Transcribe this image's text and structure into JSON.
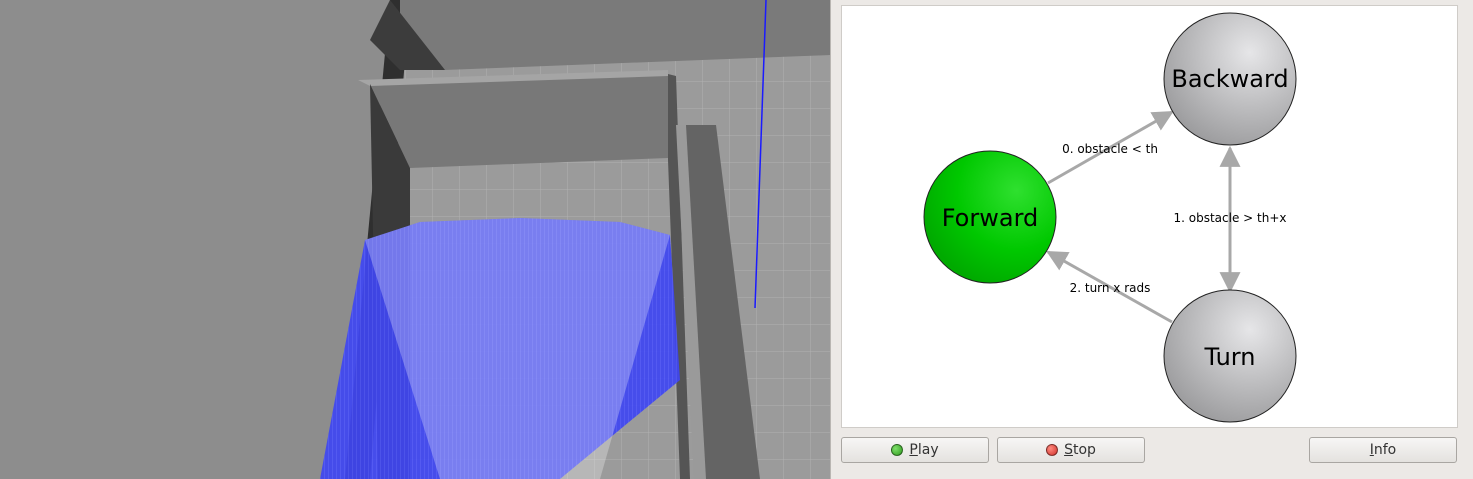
{
  "fsm": {
    "states": [
      {
        "id": "backward",
        "label": "Backward",
        "fill": "#c4c4c6",
        "active": false
      },
      {
        "id": "forward",
        "label": "Forward",
        "fill": "#00cc00",
        "active": true
      },
      {
        "id": "turn",
        "label": "Turn",
        "fill": "#c4c4c6",
        "active": false
      }
    ],
    "transitions": [
      {
        "label": "0. obstacle < th"
      },
      {
        "label": "1. obstacle > th+x"
      },
      {
        "label": "2. turn x rads"
      }
    ],
    "colors": {
      "active_state": "#00cc00",
      "inactive_state": "#c4c4c6",
      "edge": "#a8a8a8"
    }
  },
  "controls": {
    "play_label": "Play",
    "stop_label": "Stop",
    "info_label": "Info",
    "play_icon": "green-dot-icon",
    "stop_icon": "red-dot-icon",
    "play_color": "#2e9a1e",
    "stop_color": "#d0302a"
  },
  "simulation": {
    "laser_color": "#3030ff",
    "axis_color": "#1a1aff"
  }
}
